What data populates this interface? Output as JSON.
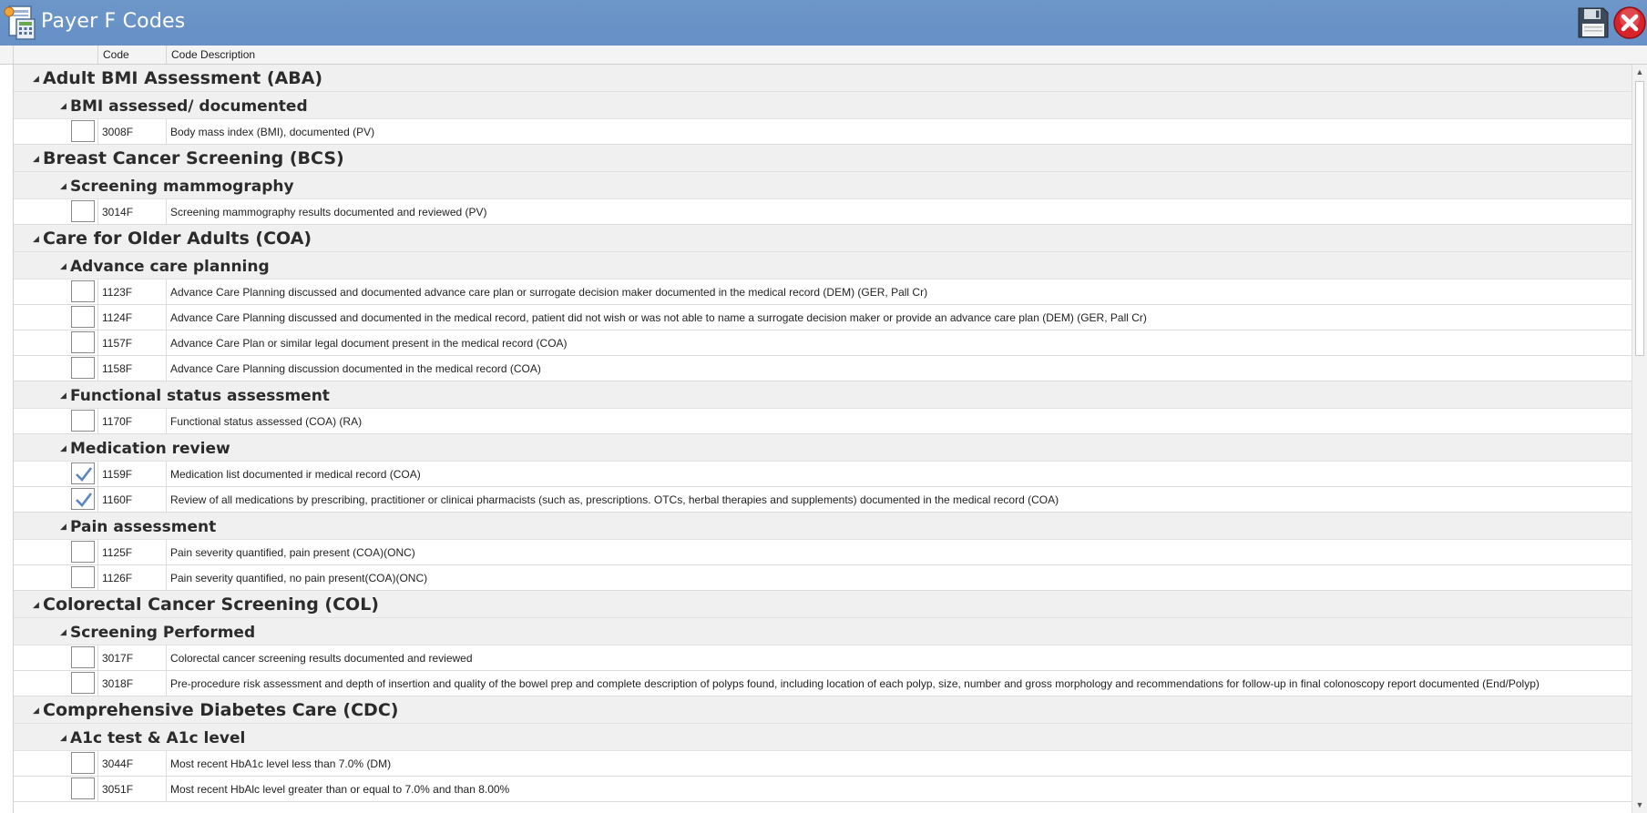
{
  "window": {
    "title": "Payer F Codes",
    "app_icon": "calculator-document-icon",
    "save_icon": "floppy-disk-icon",
    "close_icon": "red-x-close-icon"
  },
  "columns": {
    "code": "Code",
    "description": "Code Description"
  },
  "colors": {
    "titlebar": "#6690c6",
    "group_bg": "#f0f0f0",
    "check": "#5b85bf",
    "close": "#d8232a"
  },
  "groups": [
    {
      "name": "Adult BMI Assessment (ABA)",
      "subgroups": [
        {
          "name": "BMI assessed/ documented",
          "items": [
            {
              "code": "3008F",
              "desc": "Body mass index (BMI), documented (PV)",
              "checked": false
            }
          ]
        }
      ]
    },
    {
      "name": "Breast Cancer Screening (BCS)",
      "subgroups": [
        {
          "name": "Screening mammography",
          "items": [
            {
              "code": "3014F",
              "desc": "Screening mammography results documented and reviewed (PV)",
              "checked": false
            }
          ]
        }
      ]
    },
    {
      "name": "Care for Older Adults (COA)",
      "subgroups": [
        {
          "name": "Advance care planning",
          "items": [
            {
              "code": "1123F",
              "desc": "Advance Care Planning discussed and documented advance care plan or surrogate decision maker documented in the medical record (DEM) (GER, Pall Cr)",
              "checked": false
            },
            {
              "code": "1124F",
              "desc": "Advance Care Planning discussed and documented in the medical record, patient did not wish or was not able to name a surrogate decision maker or provide an advance care plan (DEM) (GER, Pall Cr)",
              "checked": false
            },
            {
              "code": "1157F",
              "desc": "Advance Care Plan or similar legal document present in the medical record (COA)",
              "checked": false
            },
            {
              "code": "1158F",
              "desc": "Advance Care Planning discussion documented in the medical record (COA)",
              "checked": false
            }
          ]
        },
        {
          "name": "Functional status assessment",
          "items": [
            {
              "code": "1170F",
              "desc": "Functional status assessed (COA) (RA)",
              "checked": false
            }
          ]
        },
        {
          "name": "Medication review",
          "items": [
            {
              "code": "1159F",
              "desc": "Medication list documented ir medical record (COA)",
              "checked": true
            },
            {
              "code": "1160F",
              "desc": "Review of all medications by prescribing, practitioner or clinicai pharmacists (such as, prescriptions. OTCs, herbal therapies and supplements) documented in the medical record (COA)",
              "checked": true
            }
          ]
        },
        {
          "name": "Pain assessment",
          "items": [
            {
              "code": "1125F",
              "desc": "Pain severity quantified, pain present (COA)(ONC)",
              "checked": false
            },
            {
              "code": "1126F",
              "desc": "Pain severity quantified, no pain present(COA)(ONC)",
              "checked": false
            }
          ]
        }
      ]
    },
    {
      "name": "Colorectal Cancer Screening (COL)",
      "subgroups": [
        {
          "name": "Screening Performed",
          "items": [
            {
              "code": "3017F",
              "desc": "Colorectal cancer screening results documented and reviewed",
              "checked": false
            },
            {
              "code": "3018F",
              "desc": "Pre-procedure risk assessment and depth of insertion and quality of the bowel prep and complete description of polyps found, including location of each polyp, size, number and gross morphology and recommendations for follow-up in final colonoscopy report documented (End/Polyp)",
              "checked": false
            }
          ]
        }
      ]
    },
    {
      "name": "Comprehensive Diabetes Care (CDC)",
      "subgroups": [
        {
          "name": "A1c test & A1c level",
          "items": [
            {
              "code": "3044F",
              "desc": "Most recent HbA1c level less than 7.0% (DM)",
              "checked": false
            },
            {
              "code": "3051F",
              "desc": "Most recent HbAlc level greater than or equal to 7.0% and than 8.00%",
              "checked": false
            }
          ]
        }
      ]
    }
  ]
}
